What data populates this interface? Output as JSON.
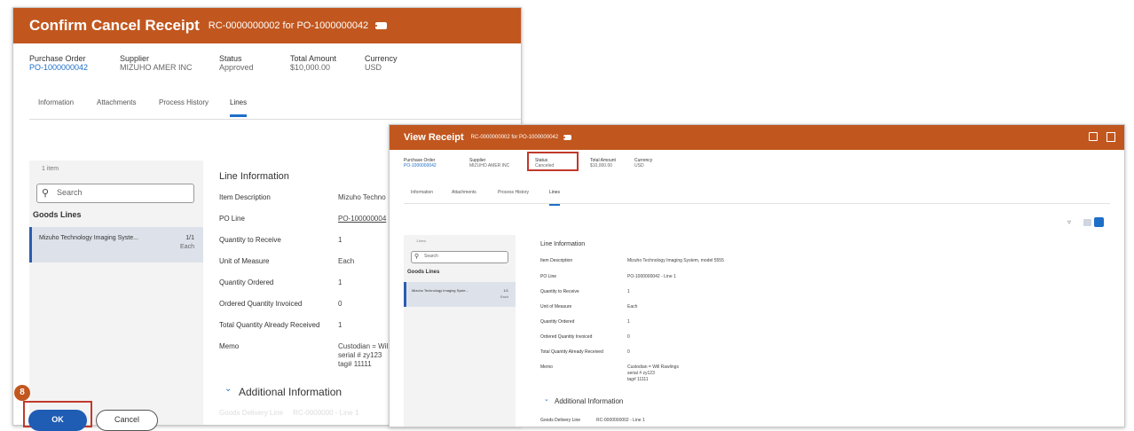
{
  "dialog": {
    "title": "Confirm Cancel Receipt",
    "subtitle": "RC-0000000002 for PO-1000000042",
    "summary": {
      "purchase_order_label": "Purchase Order",
      "purchase_order_value": "PO-1000000042",
      "supplier_label": "Supplier",
      "supplier_value": "MIZUHO AMER INC",
      "status_label": "Status",
      "status_value": "Approved",
      "total_label": "Total Amount",
      "total_value": "$10,000.00",
      "currency_label": "Currency",
      "currency_value": "USD"
    },
    "tabs": [
      "Information",
      "Attachments",
      "Process History",
      "Lines"
    ],
    "list": {
      "count": "1 item",
      "search_placeholder": "Search",
      "section": "Goods Lines",
      "item_name": "Mizuho Technology Imaging Syste...",
      "item_qty": "1/1",
      "item_unit": "Each"
    },
    "line_info": {
      "heading": "Line Information",
      "rows": [
        {
          "label": "Item Description",
          "value": "Mizuho Techno"
        },
        {
          "label": "PO Line",
          "value": "PO-100000004"
        },
        {
          "label": "Quantity to Receive",
          "value": "1"
        },
        {
          "label": "Unit of Measure",
          "value": "Each"
        },
        {
          "label": "Quantity Ordered",
          "value": "1"
        },
        {
          "label": "Ordered Quantity Invoiced",
          "value": "0"
        },
        {
          "label": "Total Quantity Already Received",
          "value": "1"
        }
      ],
      "memo_label": "Memo",
      "memo_lines": [
        "Custodian = Wil",
        "serial # zy123",
        "tag# 11111"
      ]
    },
    "additional": "Additional Information",
    "faded_row": "Goods Delivery Line     RC-0000000 - Line 1",
    "step_badge": "8",
    "ok_label": "OK",
    "cancel_label": "Cancel"
  },
  "view": {
    "title": "View Receipt",
    "subtitle": "RC-0000000002 for PO-1000000042",
    "summary": {
      "purchase_order_label": "Purchase Order",
      "purchase_order_value": "PO-1000000042",
      "supplier_label": "Supplier",
      "supplier_value": "MIZUHO AMER INC",
      "status_label": "Status",
      "status_value": "Canceled",
      "total_label": "Total Amount",
      "total_value": "$10,000.00",
      "currency_label": "Currency",
      "currency_value": "USD"
    },
    "tabs": [
      "Information",
      "Attachments",
      "Process History",
      "Lines"
    ],
    "list": {
      "count": "1 item",
      "search_placeholder": "Search",
      "section": "Goods Lines",
      "item_name": "Mizuho Technology Imaging Syste...",
      "item_qty": "1/1",
      "item_unit": "Each"
    },
    "line_info": {
      "heading": "Line Information",
      "rows": [
        {
          "label": "Item Description",
          "value": "Mizuho Technology Imaging System, model 5555"
        },
        {
          "label": "PO Line",
          "value": "PO-1000000042 - Line 1"
        },
        {
          "label": "Quantity to Receive",
          "value": "1"
        },
        {
          "label": "Unit of Measure",
          "value": "Each"
        },
        {
          "label": "Quantity Ordered",
          "value": "1"
        },
        {
          "label": "Ordered Quantity Invoiced",
          "value": "0"
        },
        {
          "label": "Total Quantity Already Received",
          "value": "0"
        }
      ],
      "memo_label": "Memo",
      "memo_lines": [
        "Custodian = Will Rawlings",
        "serial # zy123",
        "tag# 11111"
      ]
    },
    "additional": "Additional Information",
    "delivery_label": "Goods Delivery Line",
    "delivery_value": "RC-0000000002 - Line 1"
  },
  "colors": {
    "header": "#c1571f",
    "link": "#1e6fc8",
    "highlight": "#c0392b",
    "ok_button": "#1f5cb4"
  }
}
